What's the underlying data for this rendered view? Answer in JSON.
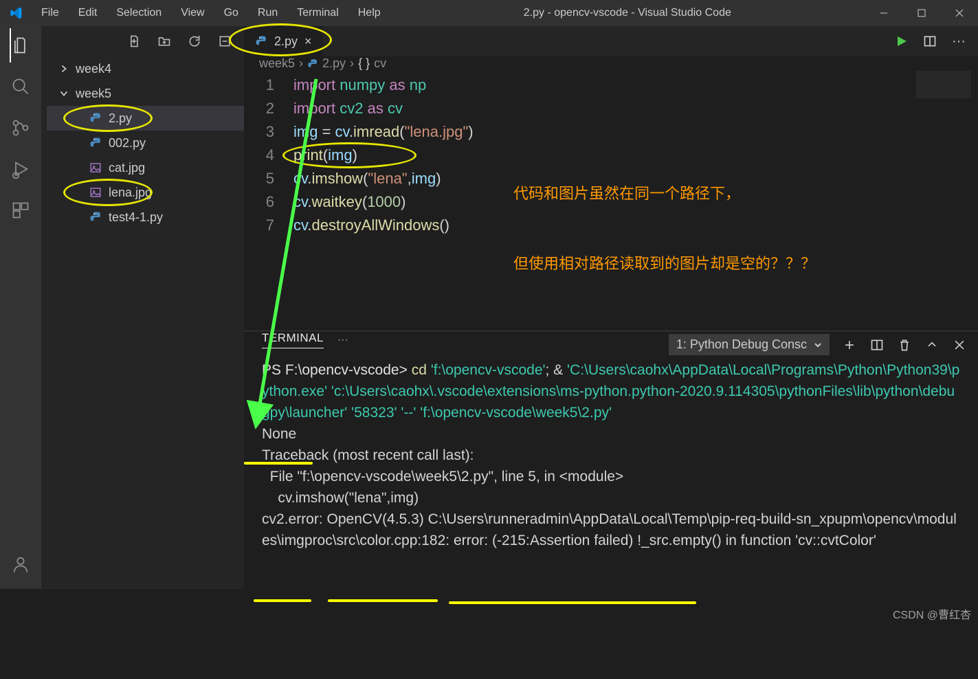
{
  "menu": [
    "File",
    "Edit",
    "Selection",
    "View",
    "Go",
    "Run",
    "Terminal",
    "Help"
  ],
  "window_title": "2.py - opencv-vscode - Visual Studio Code",
  "sidebar": {
    "folders": [
      {
        "name": "week4",
        "expanded": false
      },
      {
        "name": "week5",
        "expanded": true
      }
    ],
    "files": [
      {
        "name": "2.py",
        "kind": "py",
        "selected": true,
        "circled": true
      },
      {
        "name": "002.py",
        "kind": "py",
        "selected": false,
        "circled": false
      },
      {
        "name": "cat.jpg",
        "kind": "img",
        "selected": false,
        "circled": false
      },
      {
        "name": "lena.jpg",
        "kind": "img",
        "selected": false,
        "circled": true
      },
      {
        "name": "test4-1.py",
        "kind": "py",
        "selected": false,
        "circled": false
      }
    ]
  },
  "tab": {
    "label": "2.py"
  },
  "breadcrumb": {
    "folder": "week5",
    "file": "2.py",
    "symbol": "cv"
  },
  "code": {
    "lines": [
      [
        {
          "c": "kw",
          "t": "import"
        },
        {
          "c": "plain",
          "t": " "
        },
        {
          "c": "mod",
          "t": "numpy"
        },
        {
          "c": "plain",
          "t": " "
        },
        {
          "c": "kw",
          "t": "as"
        },
        {
          "c": "plain",
          "t": " "
        },
        {
          "c": "mod",
          "t": "np"
        }
      ],
      [
        {
          "c": "kw",
          "t": "import"
        },
        {
          "c": "plain",
          "t": " "
        },
        {
          "c": "mod",
          "t": "cv2"
        },
        {
          "c": "plain",
          "t": " "
        },
        {
          "c": "kw",
          "t": "as"
        },
        {
          "c": "plain",
          "t": " "
        },
        {
          "c": "mod",
          "t": "cv"
        }
      ],
      [
        {
          "c": "var",
          "t": "img"
        },
        {
          "c": "plain",
          "t": " = "
        },
        {
          "c": "var",
          "t": "cv"
        },
        {
          "c": "plain",
          "t": "."
        },
        {
          "c": "fn",
          "t": "imread"
        },
        {
          "c": "plain",
          "t": "("
        },
        {
          "c": "str",
          "t": "\"lena.jpg\""
        },
        {
          "c": "plain",
          "t": ")"
        }
      ],
      [
        {
          "c": "fn",
          "t": "print"
        },
        {
          "c": "plain",
          "t": "("
        },
        {
          "c": "var",
          "t": "img"
        },
        {
          "c": "plain",
          "t": ")"
        }
      ],
      [
        {
          "c": "var",
          "t": "cv"
        },
        {
          "c": "plain",
          "t": "."
        },
        {
          "c": "fn",
          "t": "imshow"
        },
        {
          "c": "plain",
          "t": "("
        },
        {
          "c": "str",
          "t": "\"lena\""
        },
        {
          "c": "plain",
          "t": ","
        },
        {
          "c": "var",
          "t": "img"
        },
        {
          "c": "plain",
          "t": ")"
        }
      ],
      [
        {
          "c": "var",
          "t": "cv"
        },
        {
          "c": "plain",
          "t": "."
        },
        {
          "c": "fn",
          "t": "waitkey"
        },
        {
          "c": "plain",
          "t": "("
        },
        {
          "c": "num",
          "t": "1000"
        },
        {
          "c": "plain",
          "t": ")"
        }
      ],
      [
        {
          "c": "var",
          "t": "cv"
        },
        {
          "c": "plain",
          "t": "."
        },
        {
          "c": "fn",
          "t": "destroyAllWindows"
        },
        {
          "c": "plain",
          "t": "()"
        }
      ]
    ]
  },
  "annotation": {
    "line1": "代码和图片虽然在同一个路径下，",
    "line2": "但使用相对路径读取到的图片却是空的？？？"
  },
  "panel": {
    "tab": "TERMINAL",
    "more": "···",
    "select": "1: Python Debug Consc",
    "lines": [
      {
        "segments": [
          {
            "c": "prompt",
            "t": "PS F:\\opencv-vscode> "
          },
          {
            "c": "cmd",
            "t": "cd"
          },
          {
            "c": "plain",
            "t": " "
          },
          {
            "c": "path",
            "t": "'f:\\opencv-vscode'"
          },
          {
            "c": "plain",
            "t": "; & "
          },
          {
            "c": "path",
            "t": "'C:\\Users\\caohx\\AppData\\Local\\Programs\\Python\\Python39\\python.exe' 'c:\\Users\\caohx\\.vscode\\extensions\\ms-python.python-2020.9.114305\\pythonFiles\\lib\\python\\debugpy\\launcher' '58323' '--' 'f:\\opencv-vscode\\week5\\2.py'"
          }
        ]
      },
      {
        "segments": [
          {
            "c": "plain",
            "t": "None"
          }
        ]
      },
      {
        "segments": [
          {
            "c": "plain",
            "t": "Traceback (most recent call last):"
          }
        ]
      },
      {
        "segments": [
          {
            "c": "plain",
            "t": "  File \"f:\\opencv-vscode\\week5\\2.py\", line 5, in <module>"
          }
        ]
      },
      {
        "segments": [
          {
            "c": "plain",
            "t": "    cv.imshow(\"lena\",img)"
          }
        ]
      },
      {
        "segments": [
          {
            "c": "plain",
            "t": "cv2.error: OpenCV(4.5.3) C:\\Users\\runneradmin\\AppData\\Local\\Temp\\pip-req-build-sn_xpupm\\opencv\\modules\\imgproc\\src\\color.cpp:182: error: (-215:Assertion failed) !_src.empty() in function 'cv::cvtColor'"
          }
        ]
      }
    ]
  },
  "watermark": "CSDN @曹红杏"
}
